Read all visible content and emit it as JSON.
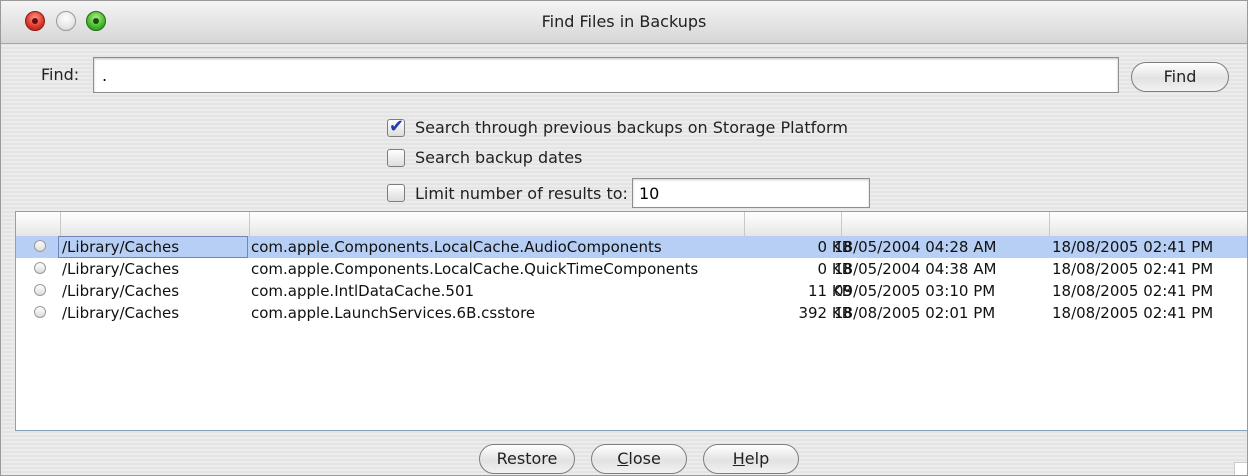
{
  "window": {
    "title": "Find Files in Backups"
  },
  "search": {
    "label": "Find:",
    "value": ".",
    "find_button": "Find"
  },
  "options": {
    "search_previous": {
      "label": "Search through previous backups on Storage Platform",
      "checked": true
    },
    "search_dates": {
      "label": "Search backup dates",
      "checked": false
    },
    "limit_results": {
      "label": "Limit number of results to:",
      "checked": false,
      "value": "10"
    }
  },
  "results": [
    {
      "path": "/Library/Caches",
      "name": "com.apple.Components.LocalCache.AudioComponents",
      "size": "0 KB",
      "modified": "18/05/2004 04:28 AM",
      "backup": "18/08/2005 02:41 PM",
      "selected": true
    },
    {
      "path": "/Library/Caches",
      "name": "com.apple.Components.LocalCache.QuickTimeComponents",
      "size": "0 KB",
      "modified": "18/05/2004 04:38 AM",
      "backup": "18/08/2005 02:41 PM",
      "selected": false
    },
    {
      "path": "/Library/Caches",
      "name": "com.apple.IntlDataCache.501",
      "size": "11 KB",
      "modified": "09/05/2005 03:10 PM",
      "backup": "18/08/2005 02:41 PM",
      "selected": false
    },
    {
      "path": "/Library/Caches",
      "name": "com.apple.LaunchServices.6B.csstore",
      "size": "392 KB",
      "modified": "18/08/2005 02:01 PM",
      "backup": "18/08/2005 02:41 PM",
      "selected": false
    }
  ],
  "buttons": {
    "restore": "Restore",
    "close_first": "C",
    "close_rest": "lose",
    "help_first": "H",
    "help_rest": "elp"
  }
}
